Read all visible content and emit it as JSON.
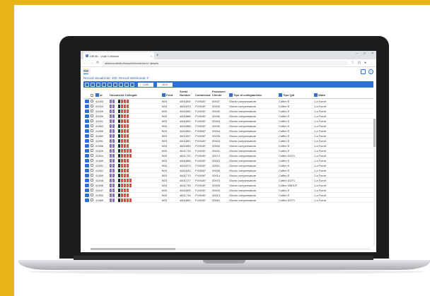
{
  "browser": {
    "tab_title": "DBI.BI - Volte Collisioni",
    "url": "dbiseccoldolto/tessutidhiceotrato.b/ dbiselo",
    "window_controls": [
      "–",
      "□",
      "×"
    ]
  },
  "app": {
    "records_text": "Record visualizzati: 100, Record selezionati: 0",
    "range_from": "1.00",
    "range_to": "10.0"
  },
  "table": {
    "headers": {
      "id": "Id",
      "documenti": "Documenti Collegati",
      "prod": "Prod.",
      "serial": "Serial Number",
      "commessa": "Commessa",
      "posizione": "Posizione Cliente",
      "tipo": "Tipo di collegamento",
      "tipo_qdi": "Tipo Qdi",
      "stato": "Stato"
    },
    "rows": [
      {
        "id": "41003",
        "prod": "B03",
        "serial": "4601805",
        "commessa": "FV/5087",
        "posizione": "00037",
        "tipo": "Giunto compensatore",
        "tq": "Coffex E",
        "stato": "1.a Fornit",
        "red": 3
      },
      {
        "id": "41004",
        "prod": "B03",
        "serial": "4601870",
        "commessa": "FV/5087",
        "posizione": "00040",
        "tipo": "Giunto compensatore",
        "tq": "Coffex E",
        "stato": "1.a Fornit",
        "red": 3
      },
      {
        "id": "41005",
        "prod": "B03",
        "serial": "4601884",
        "commessa": "FV/5087",
        "posizione": "00030",
        "tipo": "Giunto compensatore",
        "tq": "Coffex E",
        "stato": "1.a Fornit",
        "red": 3
      },
      {
        "id": "41006",
        "prod": "B03",
        "serial": "4601888",
        "commessa": "FV/5087",
        "posizione": "00030",
        "tipo": "Giunto compensatore",
        "tq": "Coffex E",
        "stato": "1.a Fornit",
        "red": 3
      },
      {
        "id": "41001",
        "prod": "B03",
        "serial": "4601890",
        "commessa": "FV/5087",
        "posizione": "00000",
        "tipo": "Giunto compensatore",
        "tq": "Coffex E",
        "stato": "1.a Fornit",
        "red": 3
      },
      {
        "id": "41663",
        "prod": "B03",
        "serial": "4601858",
        "commessa": "FV/5087",
        "posizione": "00030",
        "tipo": "Giunto compensatore",
        "tq": "Coffex E",
        "stato": "1.a Fornit",
        "red": 3
      },
      {
        "id": "41656",
        "prod": "B03",
        "serial": "4601852",
        "commessa": "FV/5087",
        "posizione": "00004",
        "tipo": "Giunto compensatore",
        "tq": "Coffex E",
        "stato": "1.a Fornit",
        "red": 3
      },
      {
        "id": "41659",
        "prod": "B03",
        "serial": "4601857",
        "commessa": "FV/5087",
        "posizione": "00030",
        "tipo": "Giunto compensatore",
        "tq": "Coffex E",
        "stato": "1.a Fornit",
        "red": 3
      },
      {
        "id": "41591",
        "prod": "B03",
        "serial": "4601851",
        "commessa": "FV/5087",
        "posizione": "00003",
        "tipo": "Giunto compensatore",
        "tq": "Coffex E",
        "stato": "1.a Fornit",
        "red": 3
      },
      {
        "id": "41556",
        "prod": "B03",
        "serial": "4601859",
        "commessa": "FV/5087",
        "posizione": "00002",
        "tipo": "Giunto compensatore",
        "tq": "Coffex E",
        "stato": "1.a Fornit",
        "red": 3
      },
      {
        "id": "41525",
        "prod": "B03",
        "serial": "4601715",
        "commessa": "FV/5087",
        "posizione": "00041",
        "tipo": "Giunto compensatore",
        "tq": "Coffex E",
        "stato": "1.a Fornit",
        "red": 4
      },
      {
        "id": "41504",
        "prod": "B03",
        "serial": "4601732",
        "commessa": "FV/5087",
        "posizione": "00074",
        "tipo": "Giunto compensatore",
        "tq": "Coffex DCF1",
        "stato": "1.a Fornit",
        "red": 4
      },
      {
        "id": "41555",
        "prod": "B03",
        "serial": "4601868",
        "commessa": "FV/5087",
        "posizione": "00004",
        "tipo": "Giunto compensatore",
        "tq": "Coffex E",
        "stato": "1.a Fornit",
        "red": 3
      },
      {
        "id": "41592",
        "prod": "B03",
        "serial": "4601879",
        "commessa": "FV/5087",
        "posizione": "00001",
        "tipo": "Giunto compensatore",
        "tq": "Coffex E",
        "stato": "1.a Fornit",
        "red": 3
      },
      {
        "id": "41551",
        "prod": "B03",
        "serial": "4601834",
        "commessa": "FV/5087",
        "posizione": "00008",
        "tipo": "Giunto compensatore",
        "tq": "Coffex E",
        "stato": "1.a Fornit",
        "red": 3
      },
      {
        "id": "41559",
        "prod": "B03",
        "serial": "4601713",
        "commessa": "FV/5087",
        "posizione": "00014",
        "tipo": "Giunto compensatore",
        "tq": "Coffex E",
        "stato": "1.a Fornit",
        "red": 3
      },
      {
        "id": "41548",
        "prod": "B03",
        "serial": "4601727",
        "commessa": "FV/5087",
        "posizione": "00070",
        "tipo": "Giunto compensatore",
        "tq": "Coffex DCF1",
        "stato": "1.a Fornit",
        "red": 4
      },
      {
        "id": "41598",
        "prod": "B03",
        "serial": "4601735",
        "commessa": "FV/5087",
        "posizione": "00005",
        "tipo": "Giunto compensatore",
        "tq": "Coffex DBHCF",
        "stato": "1.a Fornit",
        "red": 4
      },
      {
        "id": "41647",
        "prod": "B03",
        "serial": "4601805",
        "commessa": "FV/5087",
        "posizione": "00003",
        "tipo": "Giunto compensatore",
        "tq": "Coffex E",
        "stato": "1.a Fornit",
        "red": 3
      },
      {
        "id": "41550",
        "prod": "B03",
        "serial": "4601715",
        "commessa": "FV/5087",
        "posizione": "00013",
        "tipo": "Giunto compensatore",
        "tq": "Coffex E",
        "stato": "1.a Fornit",
        "red": 3
      },
      {
        "id": "41665",
        "prod": "B03",
        "serial": "4601660",
        "commessa": "FV/5087",
        "posizione": "00061",
        "tipo": "Giunto compensatore",
        "tq": "Coffex DCF1",
        "stato": "1.a Fornit",
        "red": 4
      }
    ]
  },
  "colors": {
    "accent": "#2f6fd1",
    "background": "#e8b419",
    "doc_purple": "#8a6fc9",
    "doc_dark": "#2b2b2b",
    "doc_red": "#e34a4a"
  }
}
